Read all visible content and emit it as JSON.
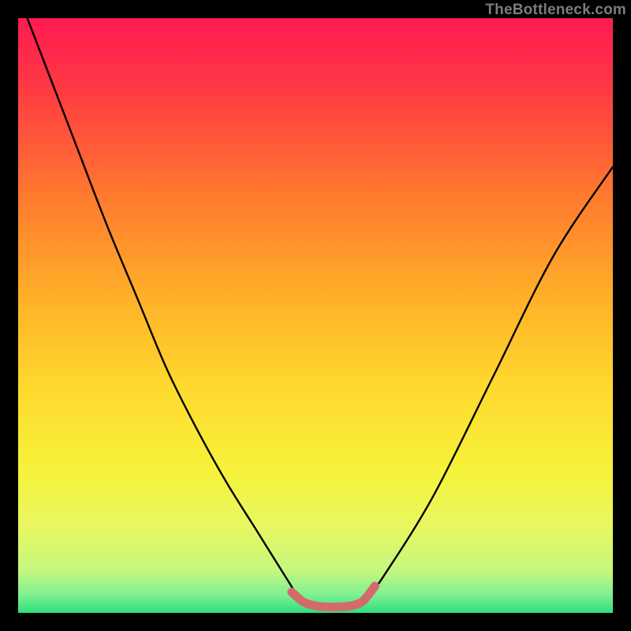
{
  "watermark": "TheBottleneck.com",
  "chart_data": {
    "type": "line",
    "title": "",
    "xlabel": "",
    "ylabel": "",
    "xlim": [
      0,
      1
    ],
    "ylim": [
      0,
      1
    ],
    "series": [
      {
        "name": "bottleneck-curve",
        "x": [
          0.0,
          0.05,
          0.1,
          0.15,
          0.2,
          0.25,
          0.3,
          0.35,
          0.4,
          0.45,
          0.47,
          0.49,
          0.51,
          0.53,
          0.55,
          0.57,
          0.59,
          0.62,
          0.7,
          0.8,
          0.9,
          1.0
        ],
        "y": [
          1.04,
          0.91,
          0.78,
          0.65,
          0.53,
          0.41,
          0.31,
          0.22,
          0.14,
          0.06,
          0.03,
          0.015,
          0.01,
          0.01,
          0.01,
          0.015,
          0.03,
          0.07,
          0.2,
          0.4,
          0.6,
          0.75
        ]
      },
      {
        "name": "optimal-band",
        "x": [
          0.46,
          0.48,
          0.5,
          0.52,
          0.54,
          0.56,
          0.58,
          0.6
        ],
        "y": [
          0.035,
          0.018,
          0.012,
          0.01,
          0.01,
          0.012,
          0.02,
          0.045
        ]
      }
    ],
    "gradient_stops": [
      {
        "offset": 0.0,
        "color": "#ff1a52"
      },
      {
        "offset": 0.12,
        "color": "#ff3a43"
      },
      {
        "offset": 0.3,
        "color": "#ff7a2e"
      },
      {
        "offset": 0.48,
        "color": "#ffb328"
      },
      {
        "offset": 0.62,
        "color": "#ffd92e"
      },
      {
        "offset": 0.76,
        "color": "#f6f23a"
      },
      {
        "offset": 0.86,
        "color": "#e7f763"
      },
      {
        "offset": 0.93,
        "color": "#c4f77f"
      },
      {
        "offset": 0.97,
        "color": "#7ef091"
      },
      {
        "offset": 1.0,
        "color": "#2de07d"
      }
    ],
    "optimal_marker_color": "#d46a6a",
    "curve_color": "#000000"
  }
}
